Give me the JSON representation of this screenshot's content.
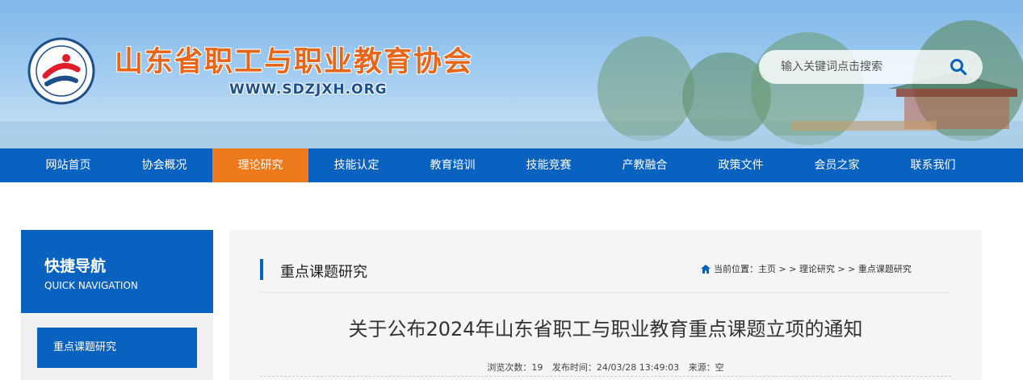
{
  "header": {
    "site_title": "山东省职工与职业教育协会",
    "site_url": "WWW.SDZJXH.ORG",
    "logo_icon": "association-logo-icon",
    "search": {
      "placeholder": "输入关键词点击搜索",
      "icon": "search-icon"
    }
  },
  "nav": {
    "items": [
      {
        "label": "网站首页"
      },
      {
        "label": "协会概况"
      },
      {
        "label": "理论研究",
        "active": true
      },
      {
        "label": "技能认定"
      },
      {
        "label": "教育培训"
      },
      {
        "label": "技能竞赛"
      },
      {
        "label": "产教融合"
      },
      {
        "label": "政策文件"
      },
      {
        "label": "会员之家"
      },
      {
        "label": "联系我们"
      }
    ]
  },
  "sidebar": {
    "title_cn": "快捷导航",
    "title_en": "QUICK NAVIGATION",
    "links": [
      {
        "label": "重点课题研究"
      }
    ]
  },
  "main": {
    "section_title": "重点课题研究",
    "breadcrumb": "当前位置：主页 > > 理论研究 > > 重点课题研究",
    "article_title": "关于公布2024年山东省职工与职业教育重点课题立项的通知",
    "meta": {
      "views": "浏览次数：19",
      "published": "发布时间：24/03/28 13:49:03",
      "source": "来源：空"
    }
  },
  "colors": {
    "primary_blue": "#0a62c0",
    "accent_orange": "#ef7a1c",
    "title_orange": "#e8661a"
  }
}
